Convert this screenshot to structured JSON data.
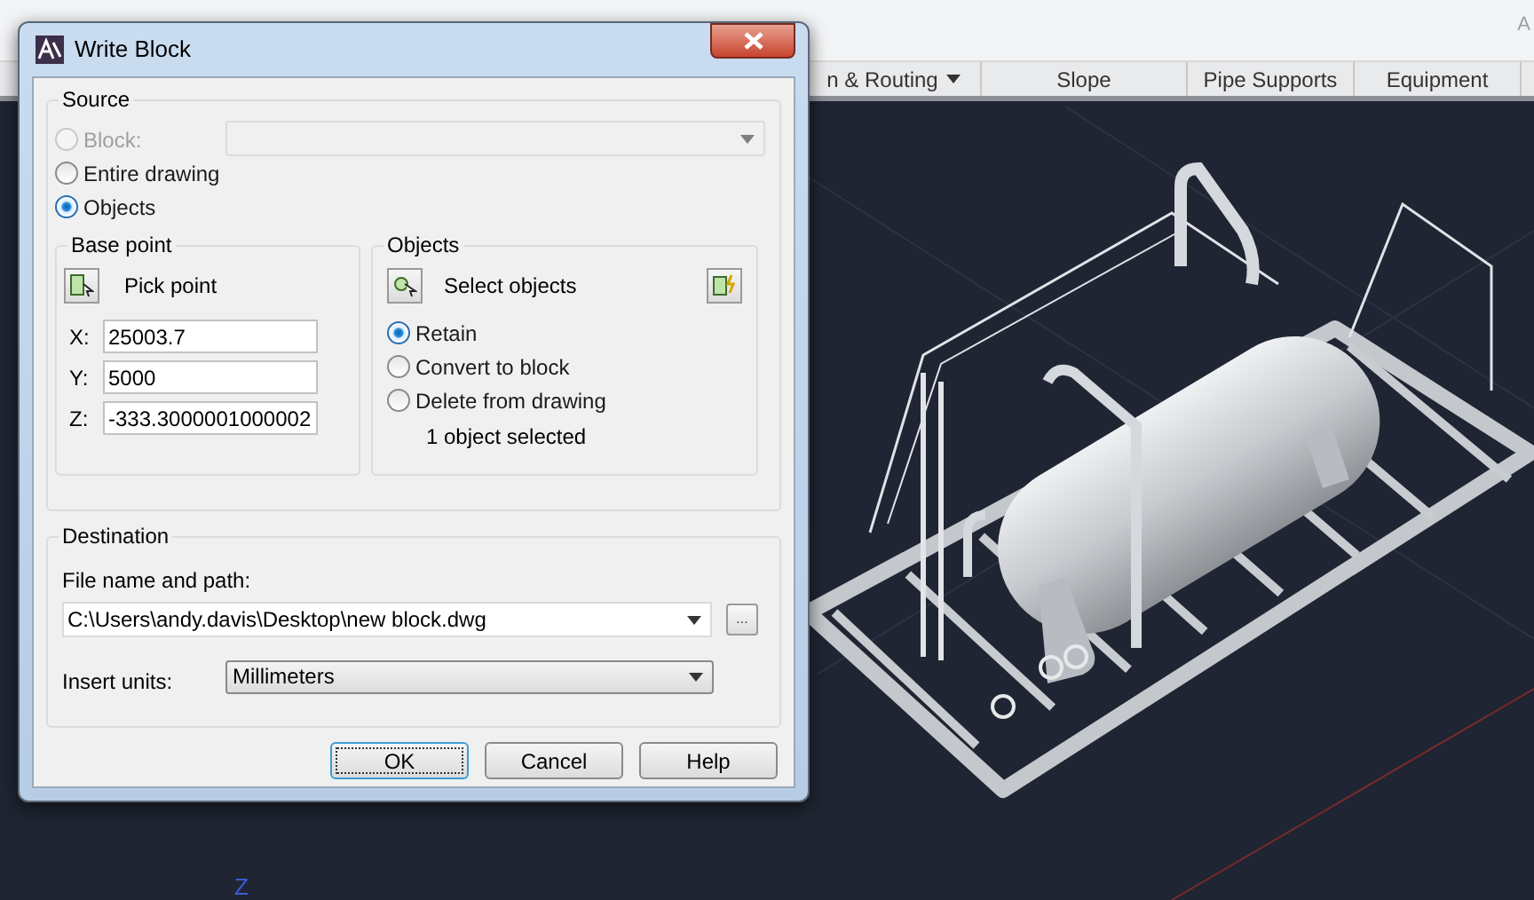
{
  "ribbon": {
    "panels": [
      {
        "label": "n & Routing",
        "dropdown": true
      },
      {
        "label": "Slope",
        "dropdown": false
      },
      {
        "label": "Pipe Supports",
        "dropdown": false
      },
      {
        "label": "Equipment",
        "dropdown": false
      }
    ],
    "cut_label": "A"
  },
  "viewport": {
    "axis_label": "Z"
  },
  "dialog": {
    "title": "Write Block",
    "source": {
      "title": "Source",
      "options": [
        {
          "label": "Block:",
          "selected": false,
          "disabled": true
        },
        {
          "label": "Entire drawing",
          "selected": false,
          "disabled": false
        },
        {
          "label": "Objects",
          "selected": true,
          "disabled": false
        }
      ],
      "block_combo": {
        "disabled": true
      }
    },
    "base_point": {
      "title": "Base point",
      "pick_button": "Pick point",
      "fields": [
        {
          "label": "X:",
          "value": "25003.7"
        },
        {
          "label": "Y:",
          "value": "5000"
        },
        {
          "label": "Z:",
          "value": "-333.3000001000002"
        }
      ]
    },
    "objects": {
      "title": "Objects",
      "select_button": "Select objects",
      "options": [
        {
          "label": "Retain",
          "selected": true
        },
        {
          "label": "Convert to block",
          "selected": false
        },
        {
          "label": "Delete from drawing",
          "selected": false
        }
      ],
      "status": "1 object selected"
    },
    "destination": {
      "title": "Destination",
      "file_label": "File name and path:",
      "file_value": "C:\\Users\\andy.davis\\Desktop\\new block.dwg",
      "browse_button": "...",
      "units_label": "Insert units:",
      "units_value": "Millimeters"
    },
    "buttons": [
      {
        "label": "OK",
        "default": true
      },
      {
        "label": "Cancel",
        "default": false
      },
      {
        "label": "Help",
        "default": false
      }
    ]
  }
}
